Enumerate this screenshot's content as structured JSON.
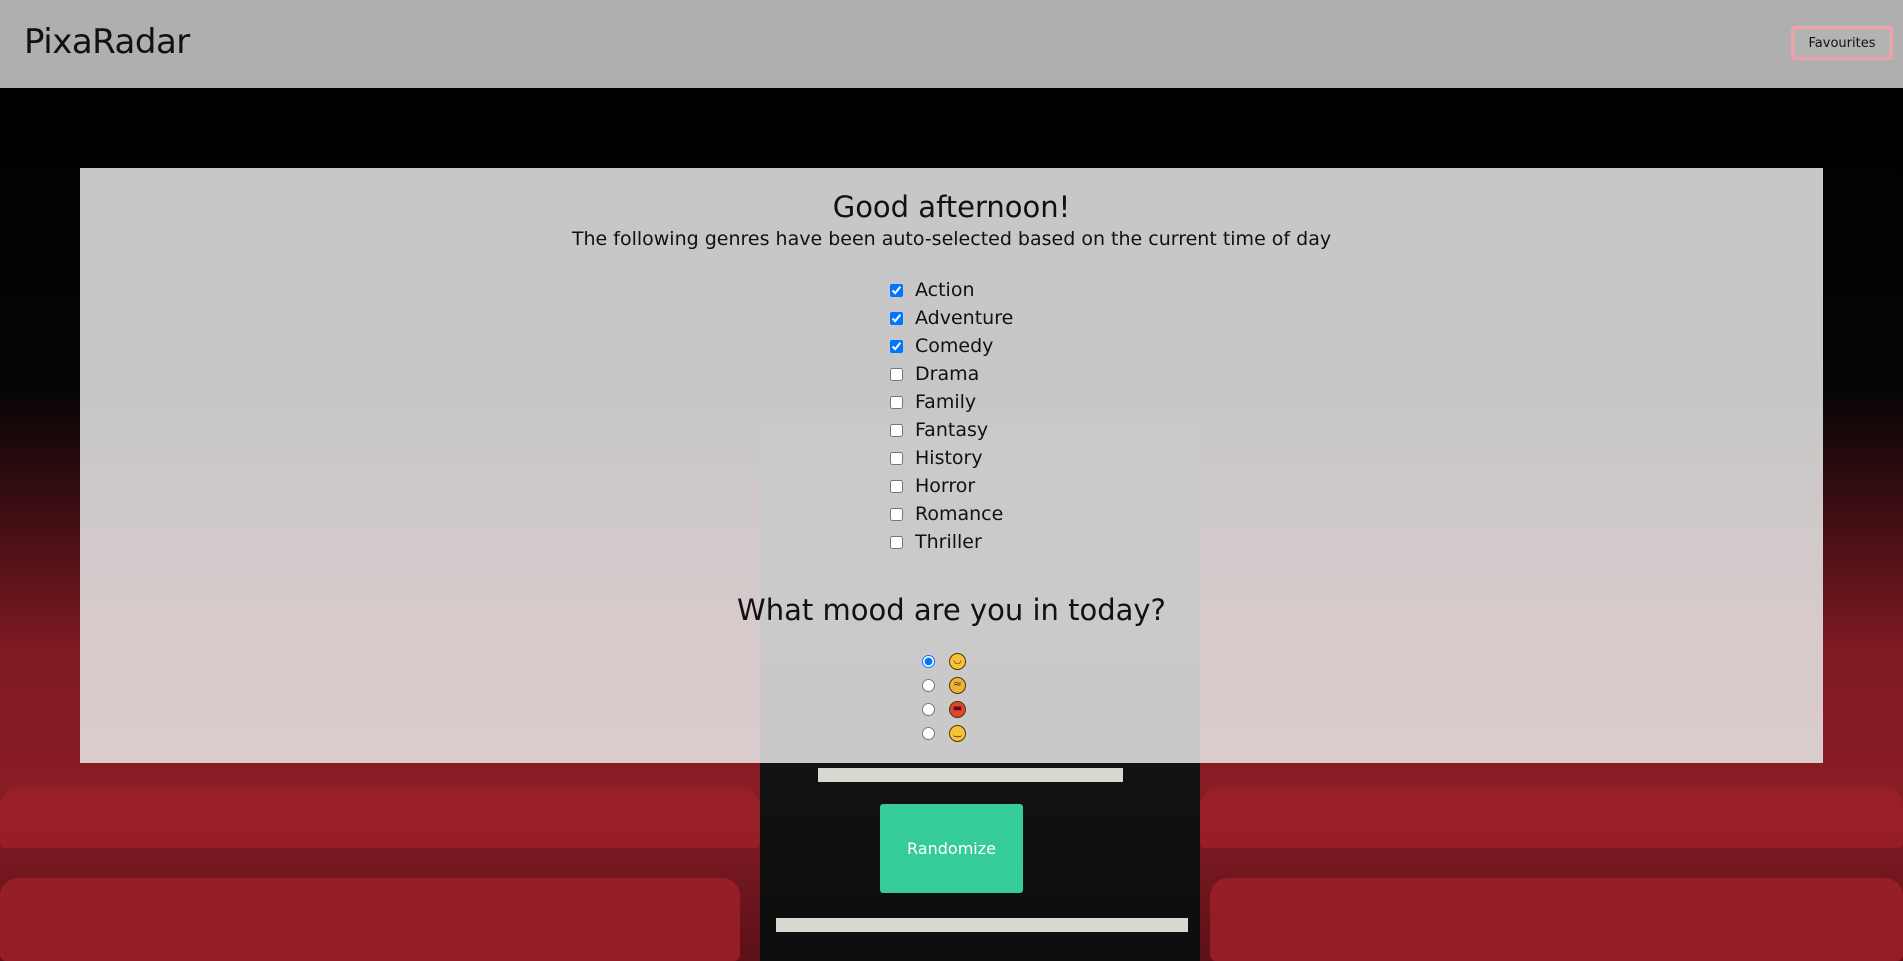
{
  "header": {
    "brand": "PixaRadar",
    "favourites_label": "Favourites"
  },
  "panel": {
    "greeting": "Good afternoon!",
    "subtitle": "The following genres have been auto-selected based on the current time of day",
    "genres": [
      {
        "label": "Action",
        "checked": true
      },
      {
        "label": "Adventure",
        "checked": true
      },
      {
        "label": "Comedy",
        "checked": true
      },
      {
        "label": "Drama",
        "checked": false
      },
      {
        "label": "Family",
        "checked": false
      },
      {
        "label": "Fantasy",
        "checked": false
      },
      {
        "label": "History",
        "checked": false
      },
      {
        "label": "Horror",
        "checked": false
      },
      {
        "label": "Romance",
        "checked": false
      },
      {
        "label": "Thriller",
        "checked": false
      }
    ],
    "mood_title": "What mood are you in today?",
    "moods": [
      {
        "icon": "happy-face-icon",
        "glyph": "◡",
        "selected": true
      },
      {
        "icon": "tired-face-icon",
        "glyph": "≈",
        "selected": false
      },
      {
        "icon": "angry-face-icon",
        "glyph": "▬",
        "selected": false
      },
      {
        "icon": "neutral-face-icon",
        "glyph": "‿",
        "selected": false
      }
    ]
  },
  "actions": {
    "randomize_label": "Randomize"
  },
  "colors": {
    "header_bg": "#afafaf",
    "accent_button": "#35cc98",
    "favourites_border": "#f3a0a8",
    "panel_bg": "#e8e8e8",
    "checkbox_accent": "#1a73e8"
  }
}
